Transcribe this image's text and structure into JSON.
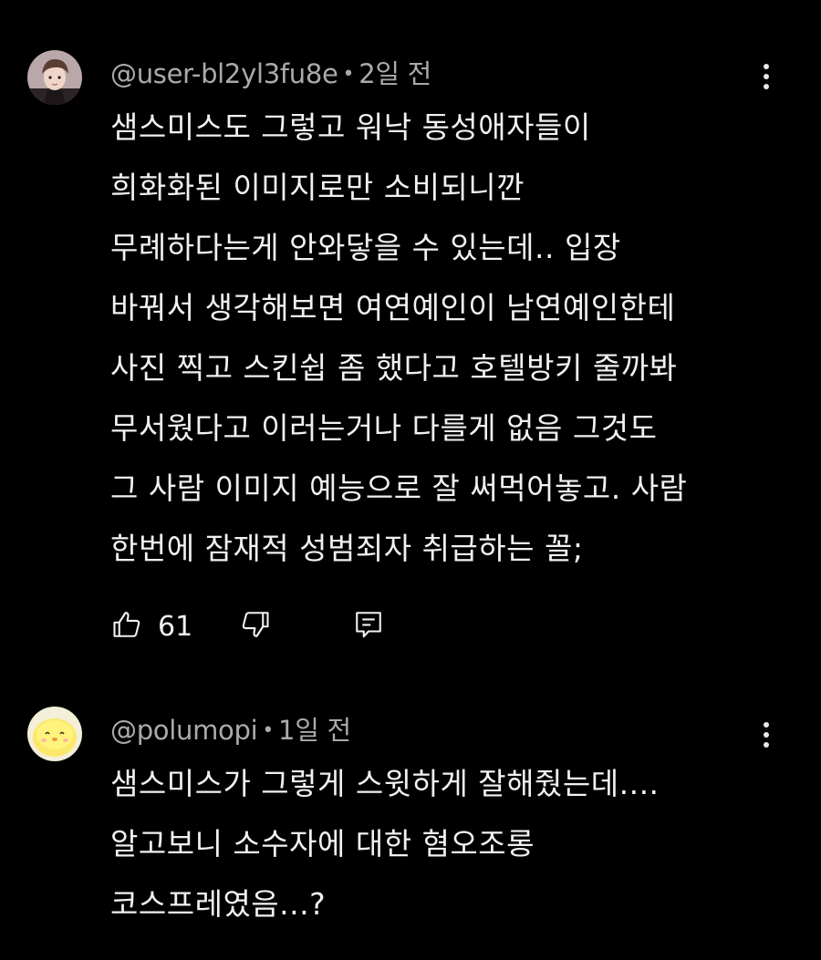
{
  "comments": [
    {
      "handle": "@user-bl2yl3fu8e",
      "time": "2일 전",
      "text": "샘스미스도 그렇고 워낙 동성애자들이\n희화화된 이미지로만 소비되니깐\n무례하다는게 안와닿을 수 있는데.. 입장\n바꿔서 생각해보면 여연예인이 남연예인한테\n사진 찍고 스킨쉽 좀 했다고 호텔방키 줄까봐\n무서웠다고 이러는거나 다를게 없음 그것도\n그 사람 이미지 예능으로 잘 써먹어놓고. 사람\n한번에 잠재적 성범죄자 취급하는 꼴;",
      "likes": "61",
      "avatar_icon": "user-avatar-man-icon"
    },
    {
      "handle": "@polumopi",
      "time": "1일 전",
      "text": "샘스미스가 그렇게 스윗하게 잘해줬는데....\n알고보니 소수자에 대한 혐오조롱\n코스프레였음...?",
      "avatar_icon": "user-avatar-yellow-chick-icon"
    }
  ],
  "separator": "•",
  "icons": {
    "like": "thumbs-up-icon",
    "dislike": "thumbs-down-icon",
    "reply": "reply-icon",
    "menu": "more-vert-icon"
  },
  "colors": {
    "background": "#000000",
    "text": "#f1f1f1",
    "meta": "#aaaaaa"
  }
}
